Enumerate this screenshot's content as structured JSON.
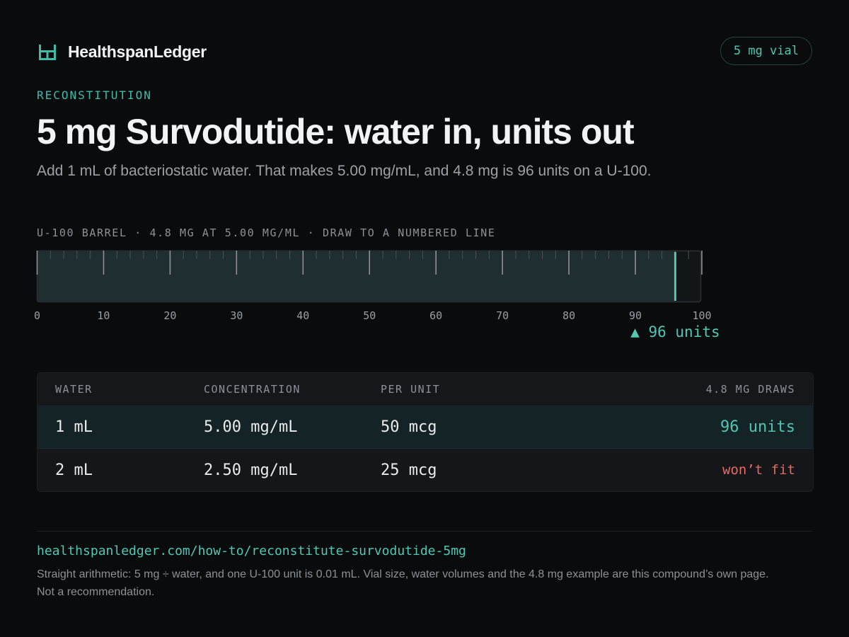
{
  "brand": {
    "name": "HealthspanLedger",
    "logo_icon": "brand-logo-icon"
  },
  "badge": {
    "label": "5 mg vial"
  },
  "hero": {
    "eyebrow": "RECONSTITUTION",
    "title": "5 mg Survodutide: water in, units out",
    "subtitle": "Add 1 mL of bacteriostatic water. That makes 5.00 mg/mL, and 4.8 mg is 96 units on a U-100."
  },
  "syringe": {
    "caption": "U-100 BARREL · 4.8 MG AT 5.00 MG/ML · DRAW TO A NUMBERED LINE",
    "min_units": 0,
    "max_units": 100,
    "major_step": 10,
    "minor_step": 2,
    "tick_labels": [
      "0",
      "10",
      "20",
      "30",
      "40",
      "50",
      "60",
      "70",
      "80",
      "90",
      "100"
    ],
    "fill_units": 96,
    "marker_label": "▲ 96 units"
  },
  "table": {
    "headers": [
      "WATER",
      "CONCENTRATION",
      "PER UNIT",
      "4.8 MG DRAWS"
    ],
    "rows": [
      {
        "water": "1 mL",
        "concentration": "5.00 mg/mL",
        "per_unit": "50 mcg",
        "draws": "96 units"
      },
      {
        "water": "2 mL",
        "concentration": "2.50 mg/mL",
        "per_unit": "25 mcg",
        "draws": "won’t fit"
      }
    ]
  },
  "footer": {
    "link": "healthspanledger.com/how-to/reconstitute-survodutide-5mg",
    "note": "Straight arithmetic: 5 mg ÷ water, and one U-100 unit is 0.01 mL. Vial size, water volumes and the 4.8 mg example are this compound’s own page. Not a recommendation."
  },
  "colors": {
    "background": "#0a0b0d",
    "accent": "#52c7b3",
    "barrel_fill": "#1e2e31",
    "warning": "#e56a5f"
  }
}
